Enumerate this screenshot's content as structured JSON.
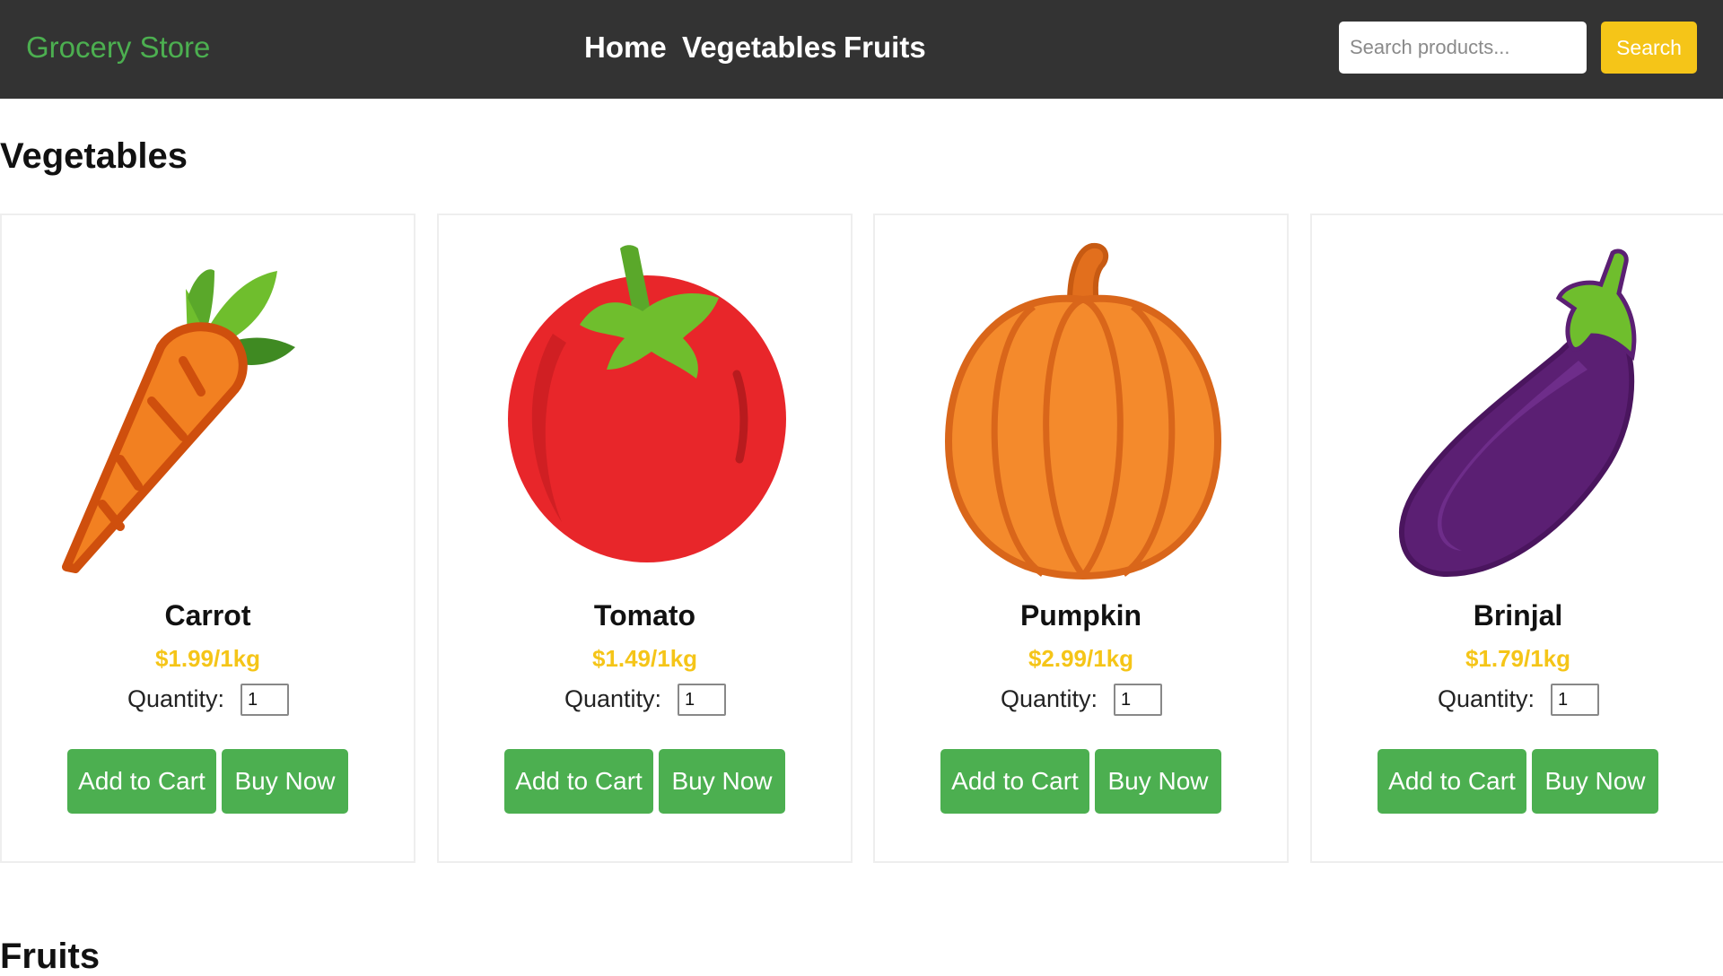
{
  "navbar": {
    "brand": "Grocery Store",
    "links": [
      "Home",
      "Vegetables",
      "Fruits"
    ],
    "search_placeholder": "Search products...",
    "search_button": "Search"
  },
  "sections": {
    "vegetables_title": "Vegetables",
    "fruits_title": "Fruits"
  },
  "products": [
    {
      "name": "Carrot",
      "price": "$1.99/1kg",
      "quantity_label": "Quantity:",
      "quantity": "1",
      "add_to_cart": "Add to Cart",
      "buy_now": "Buy Now",
      "icon": "carrot-icon"
    },
    {
      "name": "Tomato",
      "price": "$1.49/1kg",
      "quantity_label": "Quantity:",
      "quantity": "1",
      "add_to_cart": "Add to Cart",
      "buy_now": "Buy Now",
      "icon": "tomato-icon"
    },
    {
      "name": "Pumpkin",
      "price": "$2.99/1kg",
      "quantity_label": "Quantity:",
      "quantity": "1",
      "add_to_cart": "Add to Cart",
      "buy_now": "Buy Now",
      "icon": "pumpkin-icon"
    },
    {
      "name": "Brinjal",
      "price": "$1.79/1kg",
      "quantity_label": "Quantity:",
      "quantity": "1",
      "add_to_cart": "Add to Cart",
      "buy_now": "Buy Now",
      "icon": "eggplant-icon"
    }
  ],
  "colors": {
    "navbar_background": "#333333",
    "brand": "#4caf50",
    "accent_yellow": "#f5c518",
    "button_green": "#4caf50"
  }
}
